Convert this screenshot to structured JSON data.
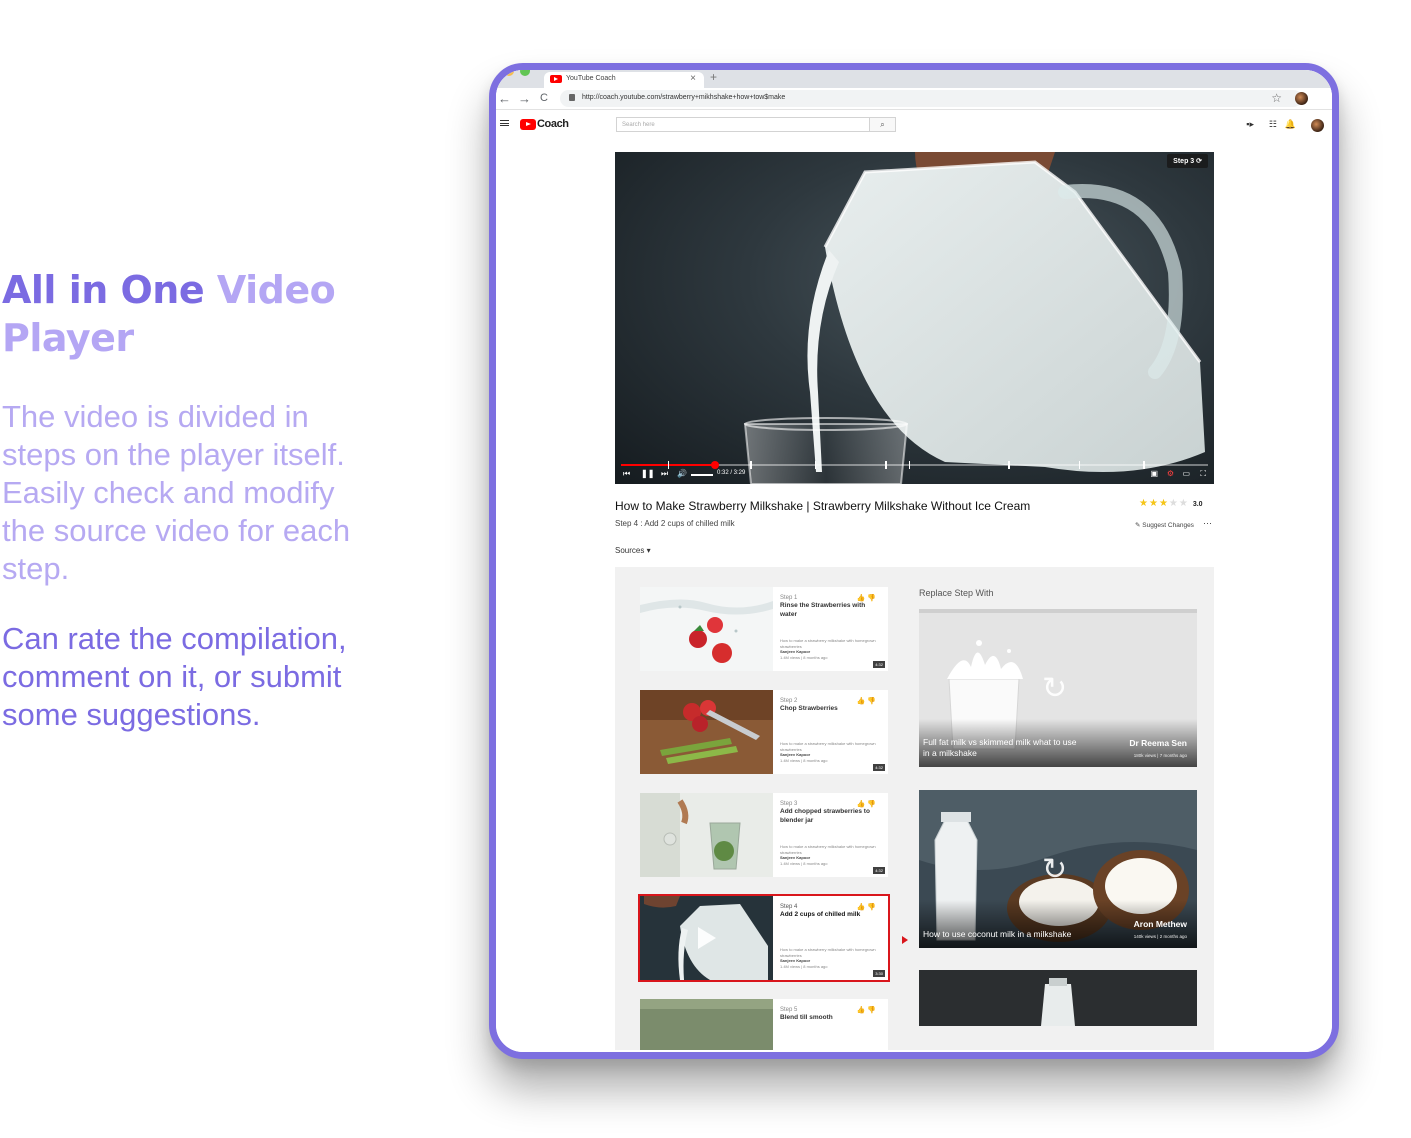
{
  "promo": {
    "title_part1": "All in One ",
    "title_part2": "Video Player",
    "paragraph1": "The video is divided in steps on the player itself. Easily check and modify the source video for each step.",
    "paragraph2": "Can rate the compilation, comment on it, or submit some suggestions."
  },
  "browser": {
    "tab_title": "YouTube Coach",
    "tab_close": "×",
    "new_tab": "+",
    "back": "←",
    "forward": "→",
    "reload": "C",
    "url": "http://coach.youtube.com/strawberry+mikhshake+how+tow$make",
    "star": "☆"
  },
  "header": {
    "logo_text": "Coach",
    "search_placeholder": "Search here",
    "search_icon": "search-icon"
  },
  "player": {
    "step_badge": "Step 3 ⟳",
    "time": "0:32 / 3:29",
    "progress_fraction": 0.16,
    "step_marks": [
      0.08,
      0.22,
      0.33,
      0.45,
      0.49,
      0.66,
      0.78,
      0.89
    ]
  },
  "video": {
    "title": "How to Make Strawberry Milkshake | Strawberry Milkshake Without Ice Cream",
    "step": "Step 4 : Add 2 cups of chilled milk",
    "rating_value": "3.0",
    "rating_stars": 3,
    "suggest_label": "✎ Suggest Changes",
    "more": "···",
    "sources_label": "Sources ▾"
  },
  "steps": [
    {
      "number": "Step 1",
      "title": "Rinse the Strawberries with water",
      "desc": "How to make a strawberry milkshake with homegrown strawberries",
      "author": "Sanjeev Kapoor",
      "stats": "1.4M views | 8 months ago",
      "duration": "4:32"
    },
    {
      "number": "Step 2",
      "title": "Chop Strawberries",
      "desc": "How to make a strawberry milkshake with homegrown strawberries",
      "author": "Sanjeev Kapoor",
      "stats": "1.4M views | 8 months ago",
      "duration": "4:32"
    },
    {
      "number": "Step 3",
      "title": "Add chopped strawberries to blender jar",
      "desc": "How to make a strawberry milkshake with homegrown strawberries",
      "author": "Sanjeev Kapoor",
      "stats": "1.4M views | 8 months ago",
      "duration": "4:32"
    },
    {
      "number": "Step 4",
      "title": "Add 2 cups of chilled milk",
      "desc": "How to make a strawberry milkshake with homegrown strawberries",
      "author": "Sanjeev Kapoor",
      "stats": "1.4M views | 8 months ago",
      "duration": "3:30"
    },
    {
      "number": "Step 5",
      "title": "Blend till smooth",
      "desc": "",
      "author": "",
      "stats": "",
      "duration": ""
    }
  ],
  "replace": {
    "title": "Replace Step With",
    "cards": [
      {
        "title": "Full fat milk vs skimmed milk what to use in a milkshake",
        "author": "Dr Reema Sen",
        "meta": "180k views | 7 months ago"
      },
      {
        "title": "How to use coconut milk in a milkshake",
        "author": "Aron Methew",
        "meta": "140k views | 2 months ago"
      }
    ]
  },
  "colors": {
    "accent": "#7b6be2",
    "accent_light": "#b4a6f4",
    "frame": "#7d6fe0",
    "youtube_red": "#ff0000",
    "active_outline": "#d9161c",
    "star": "#f5c518"
  }
}
